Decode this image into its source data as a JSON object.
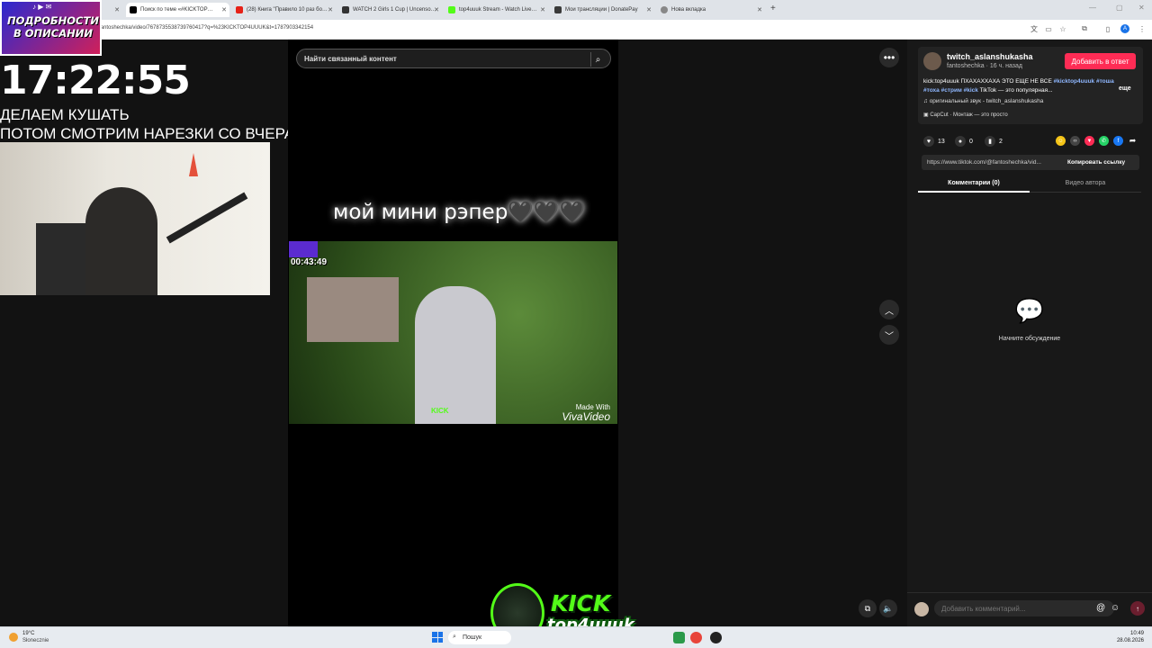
{
  "browser": {
    "tabs": [
      {
        "label": "",
        "icon": "tiktok-icon"
      },
      {
        "label": "Поиск по теме «#KICKTOP…",
        "icon": "tiktok-icon"
      },
      {
        "label": "(28) Книга \"Правило 10 раз бо…",
        "icon": "youtube-icon"
      },
      {
        "label": "WATCH 2 Girls 1 Cup | Uncenso…",
        "icon": "site-icon"
      },
      {
        "label": "top4uuuk Stream - Watch Live…",
        "icon": "kick-icon"
      },
      {
        "label": "Мои трансляции | DonatePay",
        "icon": "donatepay-icon"
      },
      {
        "label": "Нова вкладка",
        "icon": "chrome-icon"
      }
    ],
    "new_tab": "+",
    "url": "fantoshechka/video/7678735538739760417?q=%23KICKTOP4UUUK&t=1787903342154"
  },
  "overlay": {
    "promo": "ПОДРОБНОСТИ В ОПИСАНИИ",
    "clock": "17:22:55",
    "line1": "ДЕЛАЕМ КУШАТЬ",
    "line2": "ПОТОМ СМОТРИМ НАРЕЗКИ СО ВЧЕРАШНЕГО СТРИМА"
  },
  "video": {
    "search_placeholder": "Найти связанный контент",
    "caption": "мой мини рэпер🖤🖤🖤",
    "clip_timestamp": "00:43:49",
    "watermark_small": "Made With",
    "watermark_big": "VivaVideo"
  },
  "post": {
    "author": "twitch_aslanshukasha",
    "subline": "fantoshechka · 16 ч. назад",
    "reply_button": "Добавить в ответ",
    "desc_text": "kick:top4uuuk ПХАХАХХАХА ЭТО ЕЩЕ НЕ ВСЕ",
    "desc_tag1": "#kicktop4uuuk",
    "desc_tag2": "#тоша",
    "desc_tag3": "#тоха",
    "desc_tag4": "#стрим",
    "desc_tag5": "#kick",
    "desc_tail": "TikTok — это популярная...",
    "more": "еще",
    "sound": "оригинальный звук - twitch_aslanshukasha",
    "capcut": "CapCut · Монтаж — это просто",
    "likes": "13",
    "comments": "0",
    "saves": "2",
    "link": "https://www.tiktok.com/@fantoshechka/vid...",
    "copy_link": "Копировать ссылку",
    "tab_comments": "Комментарии (0)",
    "tab_author": "Видео автора",
    "empty": "Начните обсуждение",
    "comment_placeholder": "Добавить комментарий..."
  },
  "badge": {
    "kick": "KICK",
    "name": "top4uuuk"
  },
  "taskbar": {
    "temp": "19°C",
    "weather": "Słonecznie",
    "search": "Пошук",
    "time": "10:49",
    "date": "28.08.2026"
  }
}
